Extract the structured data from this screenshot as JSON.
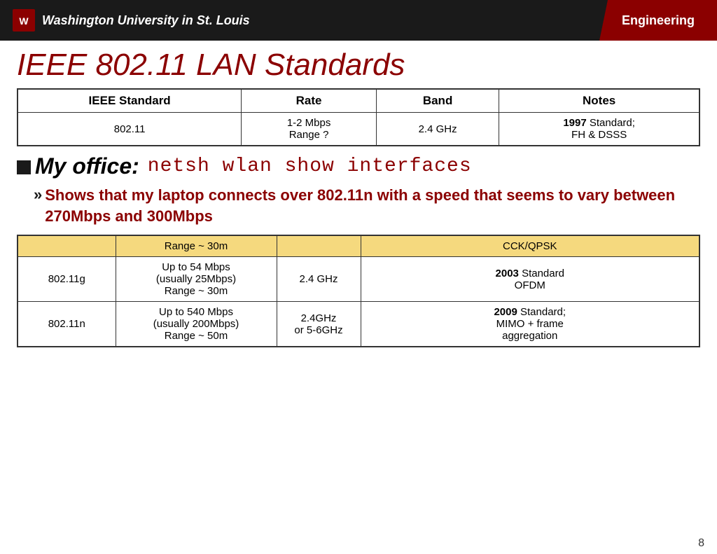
{
  "header": {
    "logo_text": "Washington University in St. Louis",
    "engineering_label": "Engineering"
  },
  "page_title": "IEEE 802.11 LAN Standards",
  "top_table": {
    "headers": [
      "IEEE Standard",
      "Rate",
      "Band",
      "Notes"
    ],
    "rows": [
      {
        "standard": "802.11",
        "rate": "1-2 Mbps\nRange ?",
        "band": "2.4 GHz",
        "notes_bold": "1997",
        "notes_rest": " Standard;\nFH & DSSS"
      }
    ]
  },
  "my_office": {
    "label": "My office:",
    "command": "netsh wlan show interfaces"
  },
  "shows_line": {
    "arrow": "»",
    "text": "Shows that my laptop connects over 802.11n with a speed that seems to vary between 270Mbps and 300Mbps"
  },
  "bottom_table": {
    "yellow_row": {
      "col1": "",
      "col2": "Range ~ 30m",
      "col3": "",
      "col4": "CCK/QPSK"
    },
    "rows": [
      {
        "standard": "802.11g",
        "rate": "Up to 54 Mbps\n(usually 25Mbps)\nRange ~ 30m",
        "band": "2.4 GHz",
        "notes_bold": "2003",
        "notes_rest": " Standard\nOFDM"
      },
      {
        "standard": "802.11n",
        "rate": "Up to 540 Mbps\n(usually 200Mbps)\nRange ~ 50m",
        "band": "2.4GHz\nor 5-6GHz",
        "notes_bold": "2009",
        "notes_rest": " Standard;\nMIMO + frame\naggregation"
      }
    ]
  },
  "page_number": "8"
}
